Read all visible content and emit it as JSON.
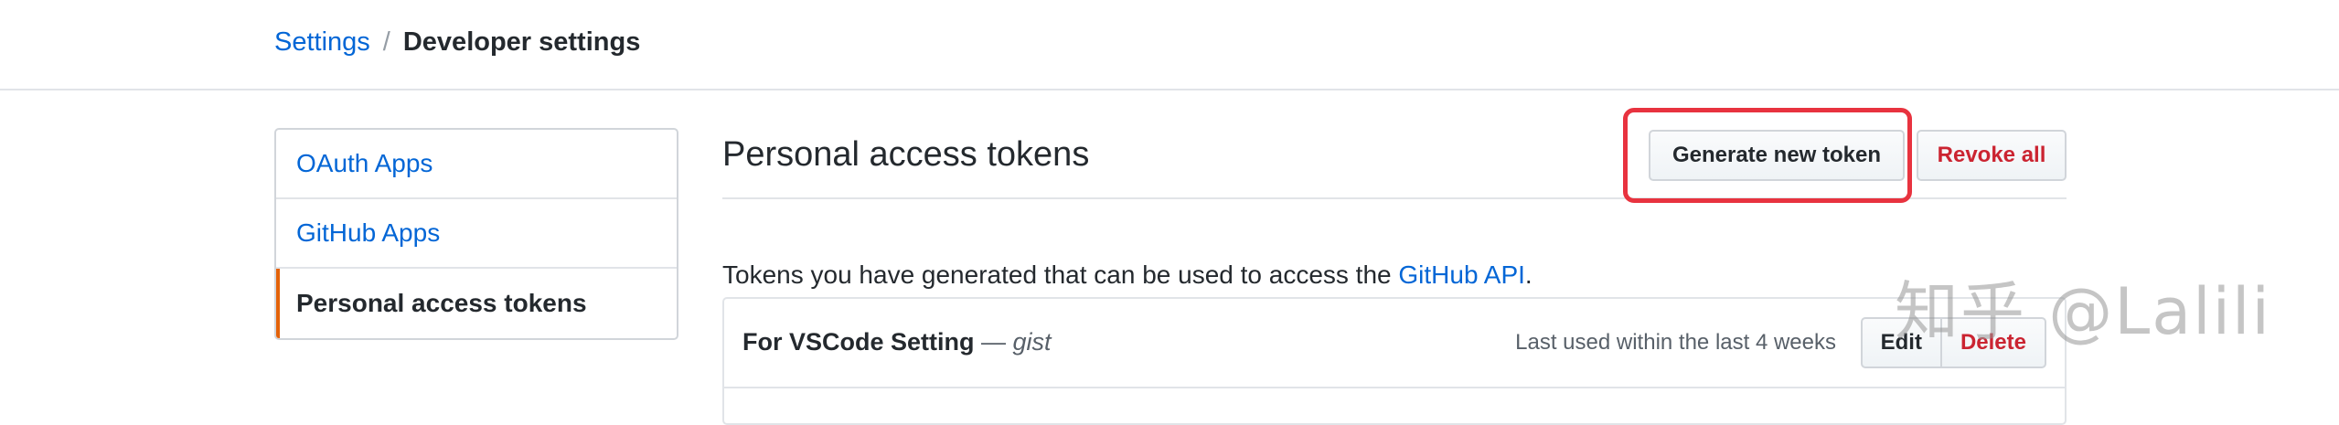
{
  "breadcrumb": {
    "root": "Settings",
    "separator": "/",
    "current": "Developer settings"
  },
  "sidebar": {
    "items": [
      {
        "label": "OAuth Apps",
        "selected": false
      },
      {
        "label": "GitHub Apps",
        "selected": false
      },
      {
        "label": "Personal access tokens",
        "selected": true
      }
    ]
  },
  "main": {
    "title": "Personal access tokens",
    "generate_label": "Generate new token",
    "revoke_label": "Revoke all",
    "description_prefix": "Tokens you have generated that can be used to access the ",
    "description_link": "GitHub API",
    "description_suffix": "."
  },
  "tokens": [
    {
      "name": "For VSCode Setting",
      "dash": " — ",
      "scope": "gist",
      "last_used": "Last used within the last 4 weeks",
      "edit_label": "Edit",
      "delete_label": "Delete"
    }
  ],
  "watermark": "知乎 @Lalili",
  "colors": {
    "link": "#0366d6",
    "danger": "#cb2431",
    "selected_accent": "#e36209",
    "highlight": "#e8333f"
  }
}
